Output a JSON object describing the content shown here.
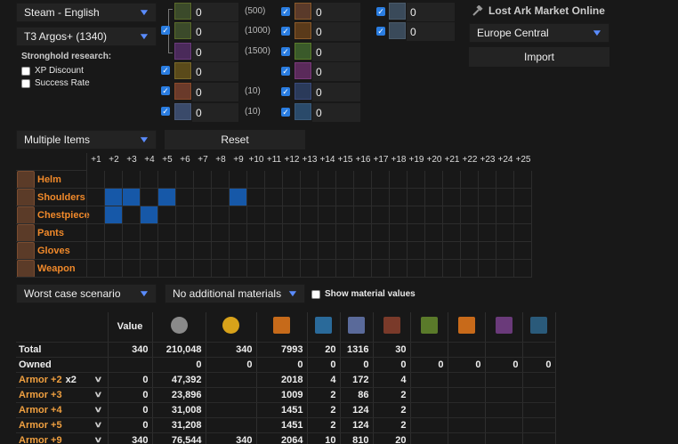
{
  "controls": {
    "region_select": "Steam - English",
    "tier_select": "T3 Argos+ (1340)",
    "stronghold_label": "Stronghold research:",
    "xp_discount": "XP Discount",
    "success_rate": "Success Rate"
  },
  "materials_left": [
    {
      "value": "0",
      "note": "(500)",
      "checked": false
    },
    {
      "value": "0",
      "note": "(1000)",
      "checked": true
    },
    {
      "value": "0",
      "note": "(1500)",
      "checked": false
    },
    {
      "value": "0",
      "note": "",
      "checked": true
    },
    {
      "value": "0",
      "note": "(10)",
      "checked": true
    },
    {
      "value": "0",
      "note": "(10)",
      "checked": true
    }
  ],
  "materials_mid": [
    "0",
    "0",
    "0",
    "0",
    "0",
    "0"
  ],
  "materials_right": [
    "0",
    "0"
  ],
  "market": {
    "title": "Lost Ark Market Online",
    "region": "Europe Central",
    "import_label": "Import"
  },
  "mode": {
    "items_select": "Multiple Items",
    "reset_label": "Reset"
  },
  "grid": {
    "levels": [
      "+1",
      "+2",
      "+3",
      "+4",
      "+5",
      "+6",
      "+7",
      "+8",
      "+9",
      "+10",
      "+11",
      "+12",
      "+13",
      "+14",
      "+15",
      "+16",
      "+17",
      "+18",
      "+19",
      "+20",
      "+21",
      "+22",
      "+23",
      "+24",
      "+25"
    ],
    "rows": [
      {
        "label": "Helm",
        "selected": []
      },
      {
        "label": "Shoulders",
        "selected": [
          2,
          3,
          5,
          9
        ]
      },
      {
        "label": "Chestpiece",
        "selected": [
          2,
          4
        ]
      },
      {
        "label": "Pants",
        "selected": []
      },
      {
        "label": "Gloves",
        "selected": []
      },
      {
        "label": "Weapon",
        "selected": []
      }
    ]
  },
  "options": {
    "scenario_select": "Worst case scenario",
    "materials_select": "No additional materials",
    "show_values": "Show material values"
  },
  "table": {
    "value_header": "Value",
    "header_icon_colors": [
      "#8a8a8a",
      "#d8a21a",
      "#c66a1a",
      "#2a6a9a",
      "#5a6a9a",
      "#7a3a2a",
      "#5a7a2a",
      "#c86a1a",
      "#6a3a7a",
      "#2a5a7a"
    ],
    "rows": [
      {
        "label": "Total",
        "qty": "",
        "cells": [
          "340",
          "210,048",
          "340",
          "7993",
          "20",
          "1316",
          "30",
          "",
          "",
          "",
          ""
        ]
      },
      {
        "label": "Owned",
        "qty": "",
        "cells": [
          "",
          "0",
          "0",
          "0",
          "0",
          "0",
          "0",
          "0",
          "0",
          "0",
          "0"
        ]
      },
      {
        "label": "Armor +2",
        "qty": "x2",
        "cells": [
          "0",
          "47,392",
          "",
          "2018",
          "4",
          "172",
          "4",
          "",
          "",
          "",
          ""
        ]
      },
      {
        "label": "Armor +3",
        "qty": "",
        "cells": [
          "0",
          "23,896",
          "",
          "1009",
          "2",
          "86",
          "2",
          "",
          "",
          "",
          ""
        ]
      },
      {
        "label": "Armor +4",
        "qty": "",
        "cells": [
          "0",
          "31,008",
          "",
          "1451",
          "2",
          "124",
          "2",
          "",
          "",
          "",
          ""
        ]
      },
      {
        "label": "Armor +5",
        "qty": "",
        "cells": [
          "0",
          "31,208",
          "",
          "1451",
          "2",
          "124",
          "2",
          "",
          "",
          "",
          ""
        ]
      },
      {
        "label": "Armor +9",
        "qty": "",
        "cells": [
          "340",
          "76,544",
          "340",
          "2064",
          "10",
          "810",
          "20",
          "",
          "",
          "",
          ""
        ]
      }
    ]
  }
}
